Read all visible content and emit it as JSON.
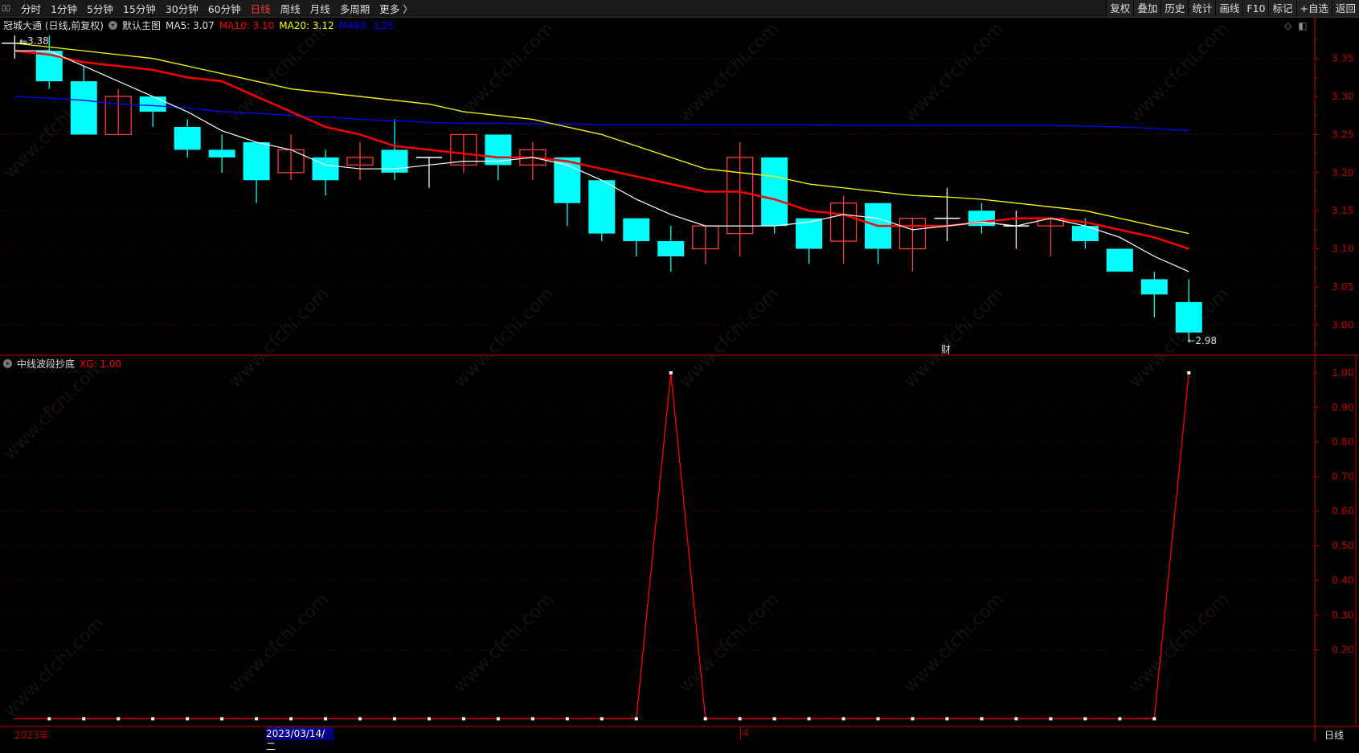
{
  "toolbar": {
    "periods": [
      "分时",
      "1分钟",
      "5分钟",
      "15分钟",
      "30分钟",
      "60分钟",
      "日线",
      "周线",
      "月线",
      "多周期",
      "更多 〉"
    ],
    "active_period": "日线",
    "actions": [
      "复权",
      "叠加",
      "历史",
      "统计",
      "画线",
      "F10",
      "标记",
      "+自选",
      "返回"
    ]
  },
  "main_chart": {
    "title": "冠城大通 (日线,前复权)",
    "template": "默认主图",
    "ma5_label": "MA5: 3.07",
    "ma10_label": "MA10: 3.10",
    "ma20_label": "MA20: 3.12",
    "ma60_label": "MA60: 3.25",
    "high_marker": "3.38",
    "low_marker": "2.98",
    "event_marker": "财",
    "colors": {
      "up": "#ff3b3b",
      "down": "#00ffff",
      "flat": "#ffffff",
      "ma5": "#ffffff",
      "ma10": "#ff0000",
      "ma20": "#ffff00",
      "ma60": "#0000ff",
      "axis": "#c00000"
    }
  },
  "indicator": {
    "name": "中线波段抄底",
    "value_label": "XG: 1.00"
  },
  "bottom_axis": {
    "year_label": "2023年",
    "cursor_date": "2023/03/14/二",
    "month_label": "4",
    "period_label": "日线"
  },
  "watermark": "www.cfchi.com",
  "chart_data": [
    {
      "type": "candlestick",
      "yticks": [
        "3.35",
        "3.30",
        "3.25",
        "3.20",
        "3.15",
        "3.10",
        "3.05",
        "3.00"
      ],
      "ylim": [
        2.97,
        3.39
      ],
      "ohlc": [
        [
          3.37,
          3.38,
          3.35,
          3.37
        ],
        [
          3.36,
          3.38,
          3.31,
          3.32
        ],
        [
          3.32,
          3.34,
          3.25,
          3.25
        ],
        [
          3.25,
          3.31,
          3.25,
          3.3
        ],
        [
          3.3,
          3.3,
          3.26,
          3.28
        ],
        [
          3.26,
          3.27,
          3.22,
          3.23
        ],
        [
          3.23,
          3.25,
          3.2,
          3.22
        ],
        [
          3.24,
          3.24,
          3.16,
          3.19
        ],
        [
          3.2,
          3.25,
          3.19,
          3.23
        ],
        [
          3.22,
          3.23,
          3.17,
          3.19
        ],
        [
          3.21,
          3.24,
          3.19,
          3.22
        ],
        [
          3.23,
          3.27,
          3.19,
          3.2
        ],
        [
          3.22,
          3.22,
          3.18,
          3.22
        ],
        [
          3.21,
          3.25,
          3.2,
          3.25
        ],
        [
          3.25,
          3.25,
          3.19,
          3.21
        ],
        [
          3.21,
          3.24,
          3.19,
          3.23
        ],
        [
          3.22,
          3.22,
          3.13,
          3.16
        ],
        [
          3.19,
          3.19,
          3.11,
          3.12
        ],
        [
          3.14,
          3.14,
          3.09,
          3.11
        ],
        [
          3.11,
          3.13,
          3.07,
          3.09
        ],
        [
          3.1,
          3.13,
          3.08,
          3.13
        ],
        [
          3.12,
          3.24,
          3.09,
          3.22
        ],
        [
          3.22,
          3.22,
          3.12,
          3.13
        ],
        [
          3.14,
          3.14,
          3.08,
          3.1
        ],
        [
          3.11,
          3.17,
          3.08,
          3.16
        ],
        [
          3.16,
          3.16,
          3.08,
          3.1
        ],
        [
          3.1,
          3.14,
          3.07,
          3.14
        ],
        [
          3.14,
          3.18,
          3.11,
          3.14
        ],
        [
          3.15,
          3.16,
          3.12,
          3.13
        ],
        [
          3.13,
          3.15,
          3.1,
          3.13
        ],
        [
          3.13,
          3.14,
          3.09,
          3.14
        ],
        [
          3.13,
          3.14,
          3.1,
          3.11
        ],
        [
          3.1,
          3.1,
          3.07,
          3.07
        ],
        [
          3.06,
          3.07,
          3.01,
          3.04
        ],
        [
          3.03,
          3.06,
          2.98,
          2.99
        ]
      ],
      "ma5": [
        3.36,
        3.36,
        3.34,
        3.32,
        3.3,
        3.28,
        3.255,
        3.24,
        3.23,
        3.21,
        3.205,
        3.205,
        3.21,
        3.215,
        3.215,
        3.22,
        3.21,
        3.19,
        3.165,
        3.145,
        3.13,
        3.13,
        3.13,
        3.135,
        3.145,
        3.14,
        3.125,
        3.13,
        3.135,
        3.13,
        3.14,
        3.13,
        3.115,
        3.09,
        3.07
      ],
      "ma10": [
        3.36,
        3.355,
        3.345,
        3.34,
        3.335,
        3.325,
        3.32,
        3.3,
        3.28,
        3.26,
        3.25,
        3.235,
        3.23,
        3.225,
        3.22,
        3.22,
        3.215,
        3.205,
        3.195,
        3.185,
        3.175,
        3.175,
        3.165,
        3.15,
        3.145,
        3.13,
        3.13,
        3.13,
        3.135,
        3.14,
        3.14,
        3.135,
        3.125,
        3.115,
        3.1
      ],
      "ma20": [
        3.37,
        3.365,
        3.36,
        3.355,
        3.35,
        3.34,
        3.33,
        3.32,
        3.31,
        3.305,
        3.3,
        3.295,
        3.29,
        3.28,
        3.275,
        3.27,
        3.26,
        3.25,
        3.235,
        3.22,
        3.205,
        3.2,
        3.195,
        3.185,
        3.18,
        3.175,
        3.17,
        3.168,
        3.165,
        3.16,
        3.155,
        3.15,
        3.14,
        3.13,
        3.12
      ],
      "ma60": [
        3.3,
        3.298,
        3.295,
        3.29,
        3.288,
        3.285,
        3.28,
        3.278,
        3.275,
        3.273,
        3.27,
        3.268,
        3.266,
        3.265,
        3.265,
        3.264,
        3.264,
        3.263,
        3.263,
        3.263,
        3.263,
        3.263,
        3.263,
        3.263,
        3.262,
        3.262,
        3.262,
        3.262,
        3.262,
        3.262,
        3.262,
        3.261,
        3.26,
        3.258,
        3.255
      ]
    },
    {
      "type": "line",
      "name": "XG",
      "yticks": [
        "1.00",
        "0.90",
        "0.80",
        "0.70",
        "0.60",
        "0.50",
        "0.40",
        "0.30",
        "0.20"
      ],
      "ylim": [
        0,
        1.0
      ],
      "values": [
        null,
        0,
        0,
        0,
        0,
        0,
        0,
        0,
        0,
        0,
        0,
        0,
        0,
        0,
        0,
        0,
        0,
        0,
        0,
        1,
        0,
        0,
        0,
        0,
        0,
        0,
        0,
        0,
        0,
        0,
        0,
        0,
        0,
        0,
        1
      ]
    }
  ]
}
